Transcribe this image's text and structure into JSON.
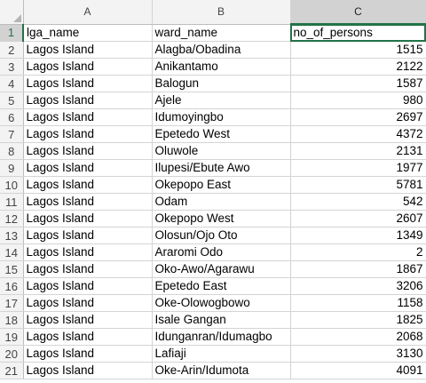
{
  "columns": [
    "A",
    "B",
    "C"
  ],
  "header_row": {
    "row_number": "1",
    "cells": [
      "lga_name",
      "ward_name",
      "no_of_persons"
    ]
  },
  "rows": [
    {
      "n": "2",
      "lga": "Lagos Island",
      "ward": "Alagba/Obadina",
      "persons": "1515"
    },
    {
      "n": "3",
      "lga": "Lagos Island",
      "ward": "Anikantamo",
      "persons": "2122"
    },
    {
      "n": "4",
      "lga": "Lagos Island",
      "ward": "Balogun",
      "persons": "1587"
    },
    {
      "n": "5",
      "lga": "Lagos Island",
      "ward": "Ajele",
      "persons": "980"
    },
    {
      "n": "6",
      "lga": "Lagos Island",
      "ward": "Idumoyingbo",
      "persons": "2697"
    },
    {
      "n": "7",
      "lga": "Lagos Island",
      "ward": "Epetedo West",
      "persons": "4372"
    },
    {
      "n": "8",
      "lga": "Lagos Island",
      "ward": "Oluwole",
      "persons": "2131"
    },
    {
      "n": "9",
      "lga": "Lagos Island",
      "ward": "Ilupesi/Ebute Awo",
      "persons": "1977"
    },
    {
      "n": "10",
      "lga": "Lagos Island",
      "ward": "Okepopo East",
      "persons": "5781"
    },
    {
      "n": "11",
      "lga": "Lagos Island",
      "ward": "Odam",
      "persons": "542"
    },
    {
      "n": "12",
      "lga": "Lagos Island",
      "ward": "Okepopo West",
      "persons": "2607"
    },
    {
      "n": "13",
      "lga": "Lagos Island",
      "ward": "Olosun/Ojo Oto",
      "persons": "1349"
    },
    {
      "n": "14",
      "lga": "Lagos Island",
      "ward": "Araromi Odo",
      "persons": "2"
    },
    {
      "n": "15",
      "lga": "Lagos Island",
      "ward": "Oko-Awo/Agarawu",
      "persons": "1867"
    },
    {
      "n": "16",
      "lga": "Lagos Island",
      "ward": "Epetedo East",
      "persons": "3206"
    },
    {
      "n": "17",
      "lga": "Lagos Island",
      "ward": "Oke-Olowogbowo",
      "persons": "1158"
    },
    {
      "n": "18",
      "lga": "Lagos Island",
      "ward": "Isale Gangan",
      "persons": "1825"
    },
    {
      "n": "19",
      "lga": "Lagos Island",
      "ward": "Idunganran/Idumagbo",
      "persons": "2068"
    },
    {
      "n": "20",
      "lga": "Lagos Island",
      "ward": "Lafiaji",
      "persons": "3130"
    },
    {
      "n": "21",
      "lga": "Lagos Island",
      "ward": "Oke-Arin/Idumota",
      "persons": "4091"
    }
  ],
  "selection": {
    "active_cell": "C1",
    "accent_color": "#217346"
  },
  "icons": {
    "select_all": "select-all-triangle-icon"
  }
}
